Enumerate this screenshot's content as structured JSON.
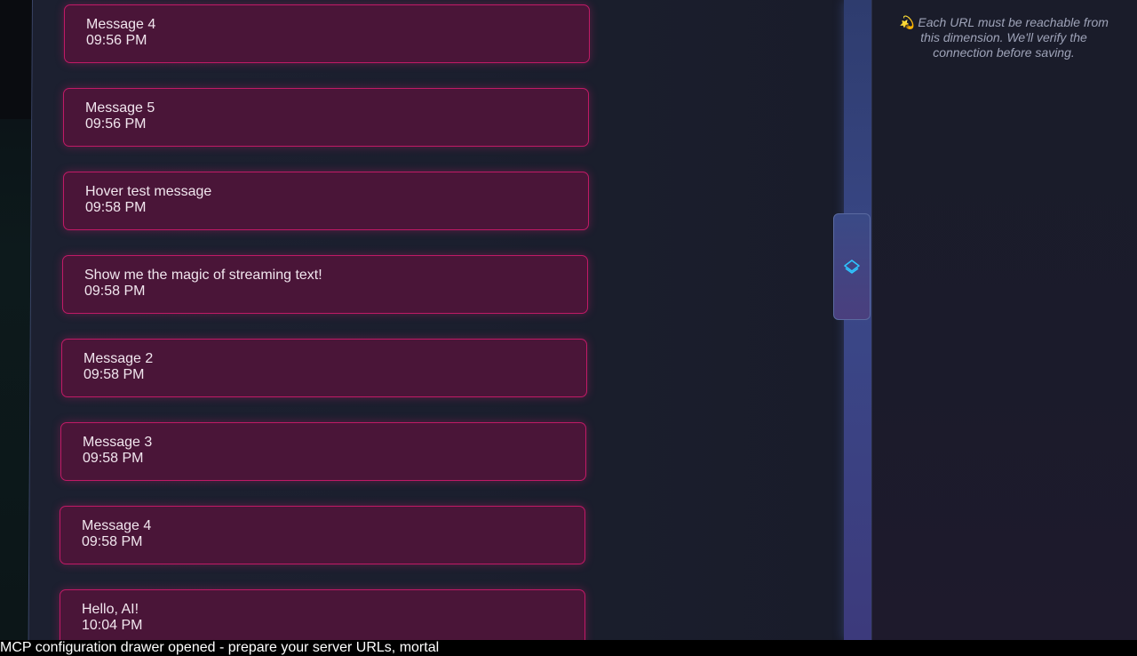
{
  "messages": [
    {
      "text": "Message 4",
      "time": "09:56 PM"
    },
    {
      "text": "Message 5",
      "time": "09:56 PM"
    },
    {
      "text": "Hover test message",
      "time": "09:58 PM"
    },
    {
      "text": "Show me the magic of streaming text!",
      "time": "09:58 PM"
    },
    {
      "text": "Message 2",
      "time": "09:58 PM"
    },
    {
      "text": "Message 3",
      "time": "09:58 PM"
    },
    {
      "text": "Message 4",
      "time": "09:58 PM"
    },
    {
      "text": "Hello, AI!",
      "time": "10:04 PM"
    }
  ],
  "drawer": {
    "hint_icon": "💫",
    "hint": "Each URL must be reachable from this dimension. We'll verify the connection before saving.",
    "handle_icon": "layers-icon"
  },
  "status": {
    "text": "MCP configuration drawer opened - prepare your server URLs, mortal"
  },
  "colors": {
    "message_bg": "#4a1538",
    "message_border": "#c01a66",
    "handle_accent": "#2ec5ff"
  }
}
